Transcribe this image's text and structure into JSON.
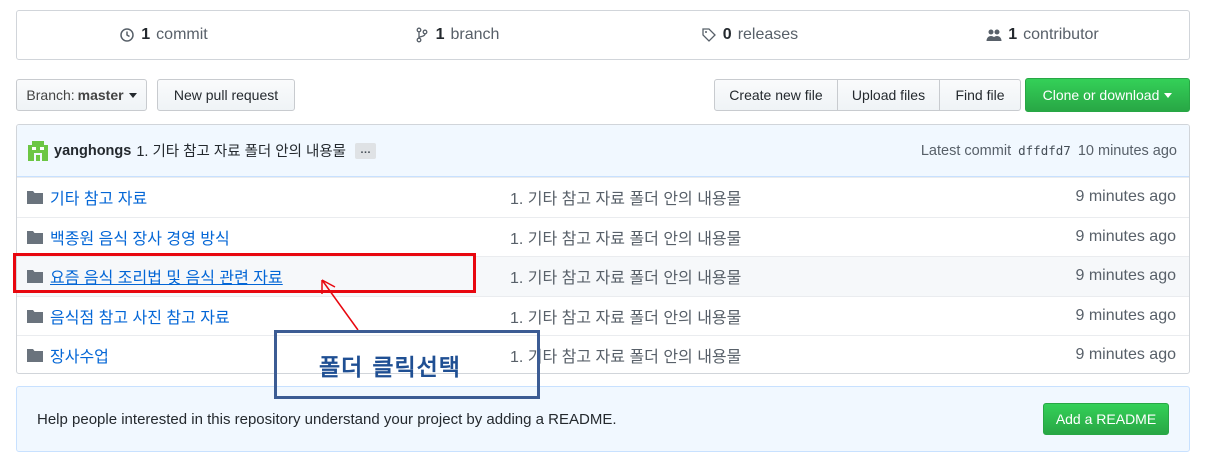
{
  "stats": {
    "commits_count": "1",
    "commits_label": "commit",
    "branches_count": "1",
    "branches_label": "branch",
    "releases_count": "0",
    "releases_label": "releases",
    "contributors_count": "1",
    "contributors_label": "contributor"
  },
  "toolbar": {
    "branch_prefix": "Branch:",
    "branch_name": "master",
    "new_pull_request": "New pull request",
    "create_new_file": "Create new file",
    "upload_files": "Upload files",
    "find_file": "Find file",
    "clone_or_download": "Clone or download"
  },
  "latest_commit": {
    "author": "yanghongs",
    "message": "1. 기타 참고 자료 폴더 안의 내용물",
    "ellipsis": "…",
    "label": "Latest commit",
    "sha": "dffdfd7",
    "age": "10 minutes ago"
  },
  "files": [
    {
      "name": "기타 참고 자료",
      "message": "1. 기타 참고 자료 폴더 안의 내용물",
      "age": "9 minutes ago"
    },
    {
      "name": "백종원 음식 장사 경영 방식",
      "message": "1. 기타 참고 자료 폴더 안의 내용물",
      "age": "9 minutes ago"
    },
    {
      "name": "요즘 음식 조리법 및 음식 관련 자료",
      "message": "1. 기타 참고 자료 폴더 안의 내용물",
      "age": "9 minutes ago"
    },
    {
      "name": "음식점 참고 사진 참고 자료",
      "message": "1. 기타 참고 자료 폴더 안의 내용물",
      "age": "9 minutes ago"
    },
    {
      "name": "장사수업",
      "message": "1. 기타 참고 자료 폴더 안의 내용물",
      "age": "9 minutes ago"
    }
  ],
  "readme": {
    "text": "Help people interested in this repository understand your project by adding a README.",
    "button": "Add a README"
  },
  "annotation": {
    "callout": "폴더 클릭선택"
  },
  "colors": {
    "link": "#0366d6",
    "green_button": "#28a745",
    "highlight_red": "#e8070f",
    "callout_blue": "#3c5c94"
  }
}
